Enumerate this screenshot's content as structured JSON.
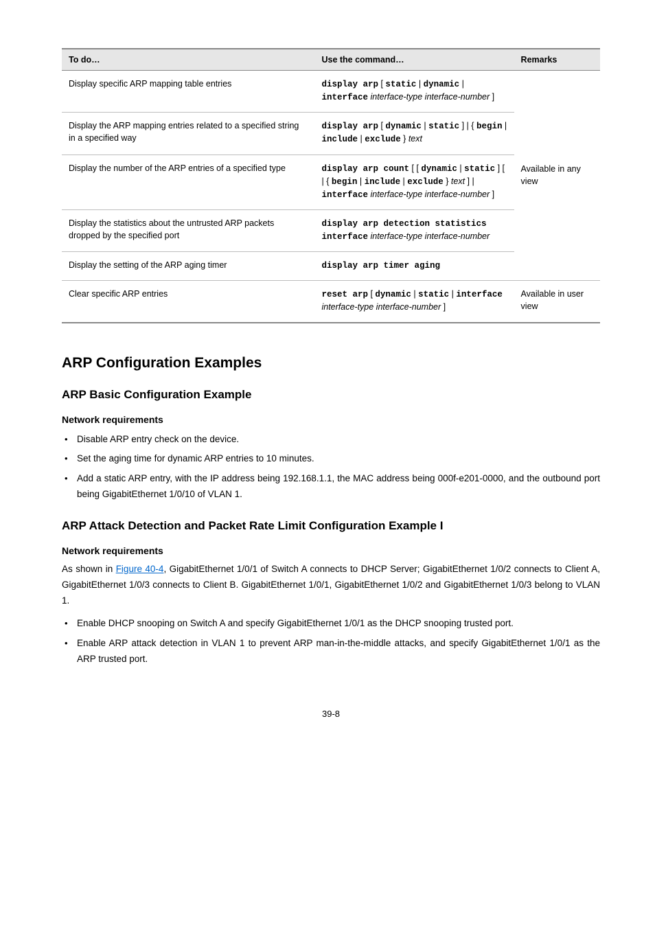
{
  "table": {
    "headers": [
      "To do…",
      "Use the command…",
      "Remarks"
    ],
    "rows": [
      {
        "to": "Display specific ARP mapping table entries",
        "cmd_parts": [
          "display arp",
          " [ ",
          "static",
          " | ",
          "dynamic",
          " | ",
          "interface",
          " ",
          "interface-type interface-number",
          " ]"
        ],
        "remark": ""
      },
      {
        "to": "Display the ARP mapping entries related to a specified string in a specified way",
        "cmd_parts": [
          "display arp",
          " [ ",
          "dynamic",
          " | ",
          "static",
          " ] | { ",
          "begin",
          " | ",
          "include",
          " | ",
          "exclude",
          " } ",
          "text"
        ],
        "remark": ""
      },
      {
        "to": "Display the number of the ARP entries of a specified type",
        "cmd_parts": [
          "display arp count",
          " [ [ ",
          "dynamic",
          " | ",
          "static",
          " ] [ | { ",
          "begin",
          " | ",
          "include",
          " | ",
          "exclude",
          " } ",
          "text",
          " ] | ",
          "interface",
          " ",
          "interface-type interface-number",
          " ]"
        ],
        "remark": "Available in any view"
      },
      {
        "to": "Display the statistics about the untrusted ARP packets dropped by the specified port",
        "cmd_parts": [
          "display arp detection statistics interface",
          " ",
          "interface-type interface-number"
        ],
        "remark": ""
      },
      {
        "to": "Display the setting of the ARP aging timer",
        "cmd_parts": [
          "display arp timer aging"
        ],
        "remark": ""
      },
      {
        "to": "Clear specific ARP entries",
        "cmd_parts": [
          "reset arp",
          " [ ",
          "dynamic",
          " | ",
          "static",
          " | ",
          "interface",
          " ",
          "interface-type interface-number",
          " ]"
        ],
        "remark": "Available in user view"
      }
    ]
  },
  "sec1_title": "ARP Configuration Examples",
  "sec1_sub": "ARP Basic Configuration Example",
  "sec1_ssub": "Network requirements",
  "sec1_bullets": [
    "Disable ARP entry check on the device.",
    "Set the aging time for dynamic ARP entries to 10 minutes.",
    "Add a static ARP entry, with the IP address being 192.168.1.1, the MAC address being 000f-e201-0000, and the outbound port being GigabitEthernet 1/0/10 of VLAN 1."
  ],
  "sec2_sub": "ARP Attack Detection and Packet Rate Limit Configuration Example I",
  "sec2_ssub": "Network requirements",
  "sec2_para_link_text": "Figure 40-4",
  "sec2_para": "As shown in {LINK}, GigabitEthernet 1/0/1 of Switch A connects to DHCP Server; GigabitEthernet 1/0/2 connects to Client A, GigabitEthernet 1/0/3 connects to Client B. GigabitEthernet 1/0/1, GigabitEthernet 1/0/2 and GigabitEthernet 1/0/3 belong to VLAN 1.",
  "sec2_bullets": [
    "Enable DHCP snooping on Switch A and specify GigabitEthernet 1/0/1 as the DHCP snooping trusted port.",
    "Enable ARP attack detection in VLAN 1 to prevent ARP man-in-the-middle attacks, and specify GigabitEthernet 1/0/1 as the ARP trusted port."
  ],
  "page_number": "39-8"
}
